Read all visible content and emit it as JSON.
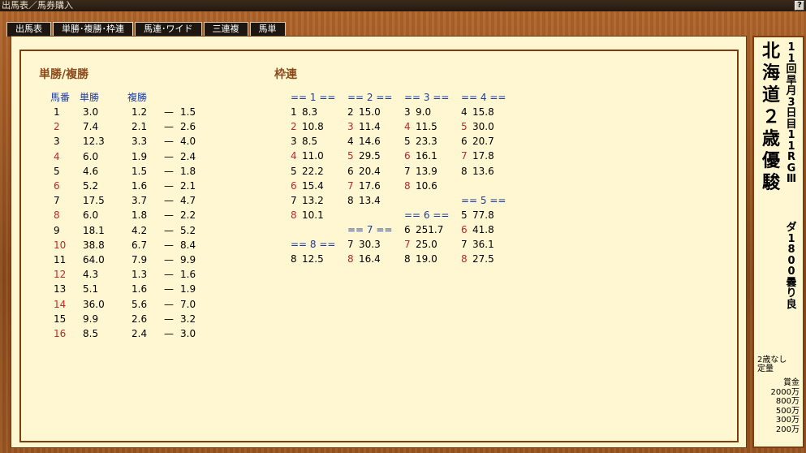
{
  "window": {
    "title": "出馬表／馬券購入",
    "help_label": "?"
  },
  "tabs": [
    {
      "label": "出馬表",
      "active": false
    },
    {
      "label": "単勝･複勝･枠連",
      "active": true
    },
    {
      "label": "馬連･ワイド",
      "active": false
    },
    {
      "label": "三連複",
      "active": false
    },
    {
      "label": "馬単",
      "active": false
    }
  ],
  "win_place": {
    "title": "単勝/複勝",
    "headers": {
      "horse": "馬番",
      "win": "単勝",
      "place": "複勝"
    },
    "rows": [
      {
        "no": "1",
        "win": "3.0",
        "p_low": "1.2",
        "p_high": "1.5"
      },
      {
        "no": "2",
        "win": "7.4",
        "p_low": "2.1",
        "p_high": "2.6"
      },
      {
        "no": "3",
        "win": "12.3",
        "p_low": "3.3",
        "p_high": "4.0"
      },
      {
        "no": "4",
        "win": "6.0",
        "p_low": "1.9",
        "p_high": "2.4"
      },
      {
        "no": "5",
        "win": "4.6",
        "p_low": "1.5",
        "p_high": "1.8"
      },
      {
        "no": "6",
        "win": "5.2",
        "p_low": "1.6",
        "p_high": "2.1"
      },
      {
        "no": "7",
        "win": "17.5",
        "p_low": "3.7",
        "p_high": "4.7"
      },
      {
        "no": "8",
        "win": "6.0",
        "p_low": "1.8",
        "p_high": "2.2"
      },
      {
        "no": "9",
        "win": "18.1",
        "p_low": "4.2",
        "p_high": "5.2"
      },
      {
        "no": "10",
        "win": "38.8",
        "p_low": "6.7",
        "p_high": "8.4"
      },
      {
        "no": "11",
        "win": "64.0",
        "p_low": "7.9",
        "p_high": "9.9"
      },
      {
        "no": "12",
        "win": "4.3",
        "p_low": "1.3",
        "p_high": "1.6"
      },
      {
        "no": "13",
        "win": "5.1",
        "p_low": "1.6",
        "p_high": "1.9"
      },
      {
        "no": "14",
        "win": "36.0",
        "p_low": "5.6",
        "p_high": "7.0"
      },
      {
        "no": "15",
        "win": "9.9",
        "p_low": "2.6",
        "p_high": "3.2"
      },
      {
        "no": "16",
        "win": "8.5",
        "p_low": "2.4",
        "p_high": "3.0"
      }
    ],
    "dash": "—"
  },
  "bracket": {
    "title": "枠連",
    "groups": [
      {
        "header": "== 1 ==",
        "pairs": [
          [
            "1",
            "8.3"
          ],
          [
            "2",
            "10.8"
          ],
          [
            "3",
            "8.5"
          ],
          [
            "4",
            "11.0"
          ],
          [
            "5",
            "22.2"
          ],
          [
            "6",
            "15.4"
          ],
          [
            "7",
            "13.2"
          ],
          [
            "8",
            "10.1"
          ]
        ]
      },
      {
        "header": "== 2 ==",
        "pairs": [
          [
            "2",
            "15.0"
          ],
          [
            "3",
            "11.4"
          ],
          [
            "4",
            "14.6"
          ],
          [
            "5",
            "29.5"
          ],
          [
            "6",
            "20.4"
          ],
          [
            "7",
            "17.6"
          ],
          [
            "8",
            "13.4"
          ]
        ]
      },
      {
        "header": "== 3 ==",
        "pairs": [
          [
            "3",
            "9.0"
          ],
          [
            "4",
            "11.5"
          ],
          [
            "5",
            "23.3"
          ],
          [
            "6",
            "16.1"
          ],
          [
            "7",
            "13.9"
          ],
          [
            "8",
            "10.6"
          ]
        ]
      },
      {
        "header": "== 4 ==",
        "pairs": [
          [
            "4",
            "15.8"
          ],
          [
            "5",
            "30.0"
          ],
          [
            "6",
            "20.7"
          ],
          [
            "7",
            "17.8"
          ],
          [
            "8",
            "13.6"
          ]
        ]
      },
      {
        "header": "== 5 ==",
        "pairs": [
          [
            "5",
            "77.8"
          ],
          [
            "6",
            "41.8"
          ],
          [
            "7",
            "36.1"
          ],
          [
            "8",
            "27.5"
          ]
        ]
      },
      {
        "header": "== 6 ==",
        "pairs": [
          [
            "6",
            "251.7"
          ],
          [
            "7",
            "25.0"
          ],
          [
            "8",
            "19.0"
          ]
        ]
      },
      {
        "header": "== 7 ==",
        "pairs": [
          [
            "7",
            "30.3"
          ],
          [
            "8",
            "16.4"
          ]
        ]
      },
      {
        "header": "== 8 ==",
        "pairs": [
          [
            "8",
            "12.5"
          ]
        ]
      }
    ]
  },
  "race": {
    "name": "北海道２歳優駿",
    "meta": "11回旱月3日目11R GⅢ",
    "track": "ダ1800 曇り 良",
    "condition_line1": "2歳なし",
    "condition_line2": "定量",
    "prize_label": "賞金",
    "prizes": [
      "2000万",
      "800万",
      "500万",
      "300万",
      "200万"
    ]
  }
}
